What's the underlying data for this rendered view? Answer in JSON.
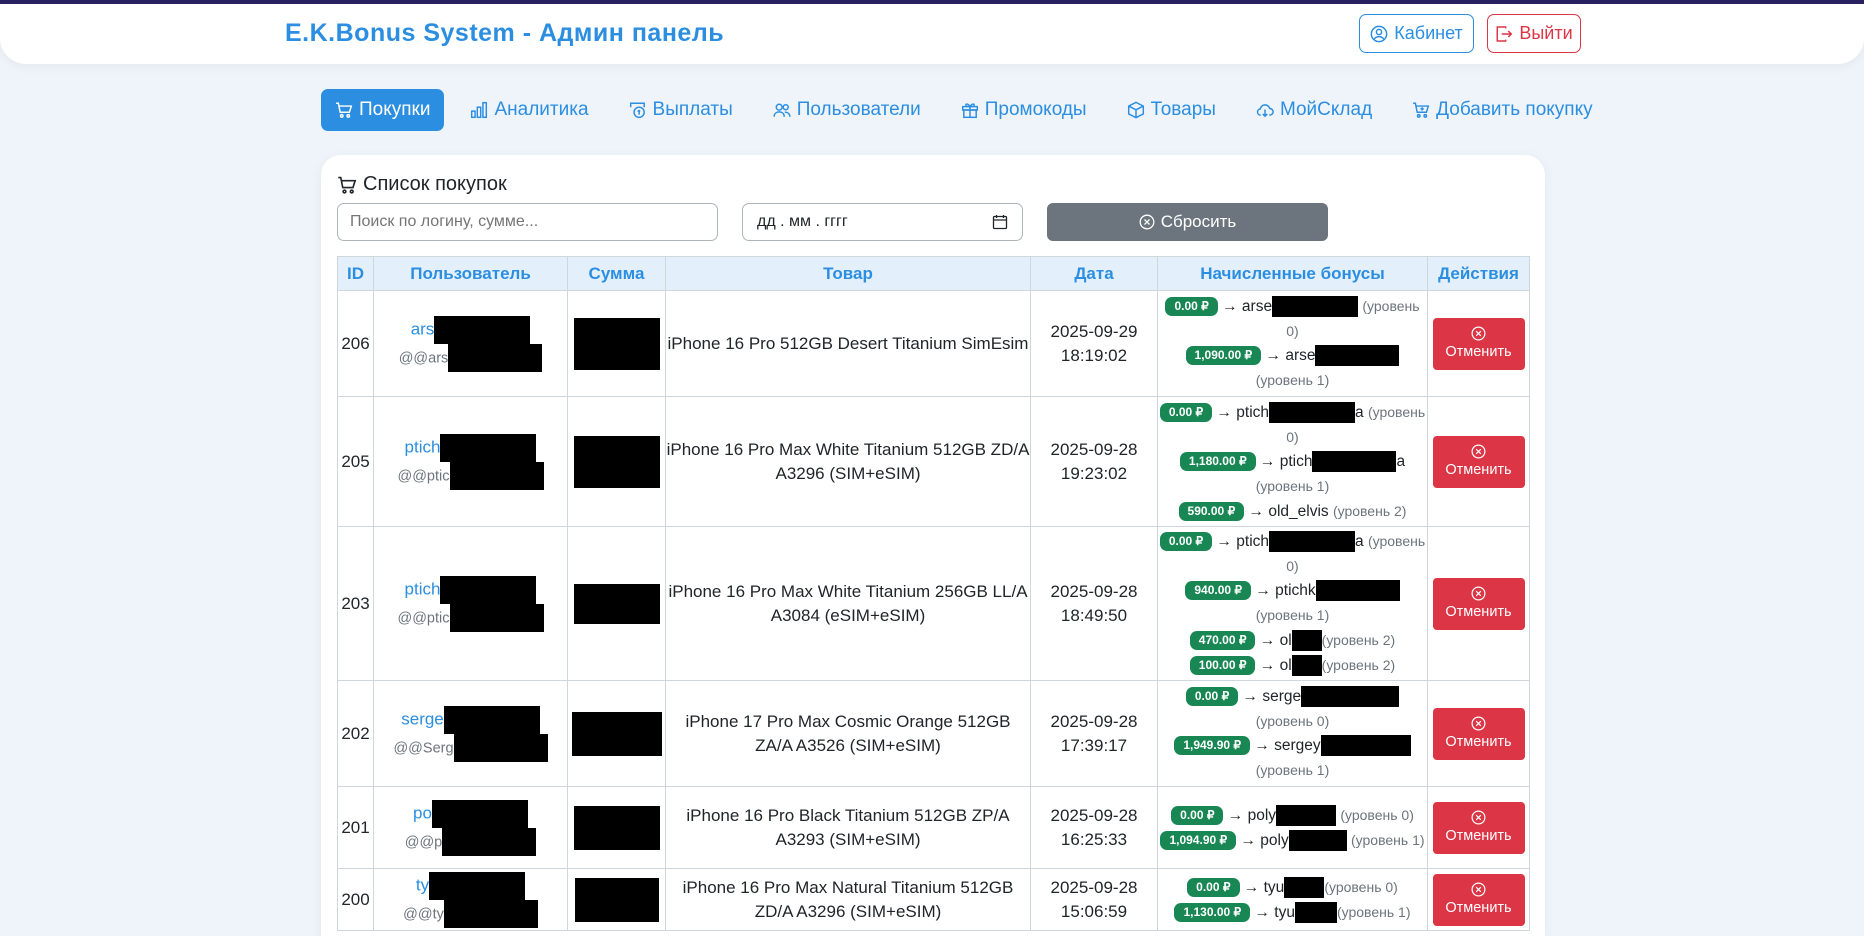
{
  "app": {
    "title": "E.K.Bonus System - Админ панель",
    "cabinet_label": "Кабинет",
    "logout_label": "Выйти"
  },
  "tabs": [
    {
      "label": "Покупки",
      "icon": "cart-icon",
      "active": true
    },
    {
      "label": "Аналитика",
      "icon": "bar-chart-icon",
      "active": false
    },
    {
      "label": "Выплаты",
      "icon": "payout-icon",
      "active": false
    },
    {
      "label": "Пользователи",
      "icon": "users-icon",
      "active": false
    },
    {
      "label": "Промокоды",
      "icon": "gift-icon",
      "active": false
    },
    {
      "label": "Товары",
      "icon": "box-icon",
      "active": false
    },
    {
      "label": "МойСклад",
      "icon": "cloud-download-icon",
      "active": false
    },
    {
      "label": "Добавить покупку",
      "icon": "cart-plus-icon",
      "active": false
    }
  ],
  "purchases": {
    "title": "Список покупок",
    "search_placeholder": "Поиск по логину, сумме...",
    "date_placeholder": "дд . мм . гггг",
    "reset_label": "Сбросить",
    "columns": [
      "ID",
      "Пользователь",
      "Сумма",
      "Товар",
      "Дата",
      "Начисленные бонусы",
      "Действия"
    ],
    "cancel_label": "Отменить",
    "rows": [
      {
        "id": "206",
        "user": "ars",
        "handle": "@@ars",
        "product": "iPhone 16 Pro 512GB Desert Titanium SimEsim",
        "date": "2025-09-29",
        "time": "18:19:02",
        "bonuses": [
          {
            "amount": "0.00 ₽",
            "login": "arse",
            "level": "(уровень 0)"
          },
          {
            "amount": "1,090.00 ₽",
            "login": "arse",
            "level": "(уровень 1)"
          }
        ]
      },
      {
        "id": "205",
        "user": "ptich",
        "handle": "@@ptic",
        "product": "iPhone 16 Pro Max White Titanium 512GB ZD/A A3296 (SIM+eSIM)",
        "date": "2025-09-28",
        "time": "19:23:02",
        "bonuses": [
          {
            "amount": "0.00 ₽",
            "login": "ptich",
            "suffix": "a",
            "level": "(уровень 0)"
          },
          {
            "amount": "1,180.00 ₽",
            "login": "ptich",
            "suffix": "a",
            "level": "(уровень 1)"
          },
          {
            "amount": "590.00 ₽",
            "login": "old_elvis",
            "level": "(уровень 2)"
          }
        ]
      },
      {
        "id": "203",
        "user": "ptich",
        "handle": "@@ptic",
        "product": "iPhone 16 Pro Max White Titanium 256GB LL/A A3084 (eSIM+eSIM)",
        "date": "2025-09-28",
        "time": "18:49:50",
        "bonuses": [
          {
            "amount": "0.00 ₽",
            "login": "ptich",
            "suffix": "a",
            "level": "(уровень 0)"
          },
          {
            "amount": "940.00 ₽",
            "login": "ptichk",
            "level": "(уровень 1)"
          },
          {
            "amount": "470.00 ₽",
            "login": "ol",
            "level": "(уровень 2)"
          },
          {
            "amount": "100.00 ₽",
            "login": "ol",
            "level": "(уровень 2)"
          }
        ]
      },
      {
        "id": "202",
        "user": "serge",
        "handle": "@@Serg",
        "product": "iPhone 17 Pro Max Cosmic Orange 512GB ZA/A A3526 (SIM+eSIM)",
        "date": "2025-09-28",
        "time": "17:39:17",
        "bonuses": [
          {
            "amount": "0.00 ₽",
            "login": "serge",
            "level": "(уровень 0)"
          },
          {
            "amount": "1,949.90 ₽",
            "login": "sergey",
            "level": "(уровень 1)"
          }
        ]
      },
      {
        "id": "201",
        "user": "po",
        "handle": "@@p",
        "product": "iPhone 16 Pro Black Titanium 512GB ZP/A A3293 (SIM+eSIM)",
        "date": "2025-09-28",
        "time": "16:25:33",
        "bonuses": [
          {
            "amount": "0.00 ₽",
            "login": "poly",
            "level": "(уровень 0)"
          },
          {
            "amount": "1,094.90 ₽",
            "login": "poly",
            "level": "(уровень 1)"
          }
        ]
      },
      {
        "id": "200",
        "user": "ty",
        "handle": "@@ty",
        "product": "iPhone 16 Pro Max Natural Titanium 512GB ZD/A A3296 (SIM+eSIM)",
        "date": "2025-09-28",
        "time": "15:06:59",
        "bonuses": [
          {
            "amount": "0.00 ₽",
            "login": "tyu",
            "level": "(уровень 0)"
          },
          {
            "amount": "1,130.00 ₽",
            "login": "tyu",
            "level": "(уровень 1)"
          }
        ]
      }
    ]
  }
}
